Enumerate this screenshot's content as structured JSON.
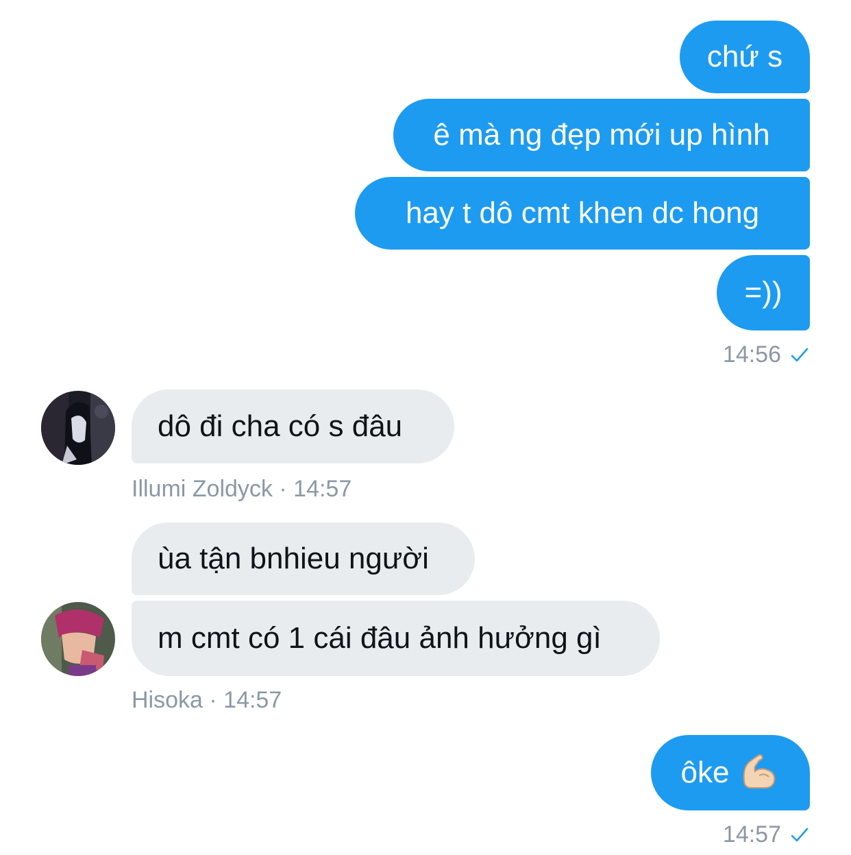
{
  "outgoing_group_1": {
    "messages": [
      "chứ s",
      "ê mà ng đẹp mới up hình",
      "hay t dô cmt khen dc hong",
      "=))"
    ],
    "time": "14:56"
  },
  "incoming_group_1": {
    "messages": [
      "dô đi cha có s đâu"
    ],
    "sender": "Illumi Zoldyck",
    "separator": "·",
    "time": "14:57",
    "avatar_icon": "illumi-avatar"
  },
  "incoming_group_2": {
    "messages": [
      "ùa tận bnhieu người",
      "m cmt có 1 cái đâu ảnh hưởng gì"
    ],
    "sender": "Hisoka",
    "separator": "·",
    "time": "14:57",
    "avatar_icon": "hisoka-avatar"
  },
  "outgoing_group_2": {
    "messages": [
      "ôke"
    ],
    "emoji": "flexed-biceps-emoji",
    "time": "14:57"
  },
  "colors": {
    "outgoing_bubble": "#1d9bf0",
    "incoming_bubble": "#e9ecef",
    "meta_text": "#8b98a5",
    "read_check": "#1d9bf0"
  }
}
